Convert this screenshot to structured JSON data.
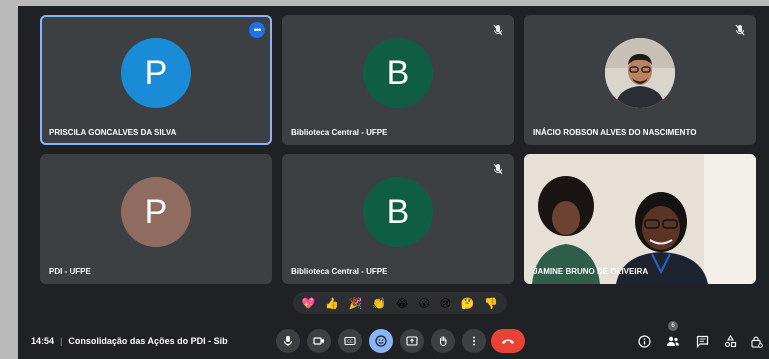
{
  "participants": [
    {
      "name": "PRISCILA GONCALVES DA SILVA",
      "initial": "P",
      "avatar_color": "#1a8bd6",
      "active": true,
      "muted": false
    },
    {
      "name": "Biblioteca Central - UFPE",
      "initial": "B",
      "avatar_color": "#0f5e44",
      "muted": true
    },
    {
      "name": "INÁCIO ROBSON ALVES DO NASCIMENTO",
      "avatar_type": "photo",
      "muted": true
    },
    {
      "name": "PDI - UFPE",
      "initial": "P",
      "avatar_color": "#8f6c5f",
      "muted": false
    },
    {
      "name": "Biblioteca Central - UFPE",
      "initial": "B",
      "avatar_color": "#0f5e44",
      "muted": true
    },
    {
      "name": "JAMINE BRUNO DE OLIVEIRA",
      "avatar_type": "video",
      "muted": false
    }
  ],
  "reactions": [
    "💖",
    "👍",
    "🎉",
    "👏",
    "😂",
    "😮",
    "😢",
    "🤔",
    "👎"
  ],
  "footer": {
    "time": "14:54",
    "separator": "|",
    "meeting_title": "Consolidação das Ações do PDI - Sib",
    "participants_count": "6"
  },
  "controls": [
    "mic-icon",
    "camera-icon",
    "captions-icon",
    "emoji-icon",
    "present-icon",
    "raise-hand-icon",
    "more-options-icon",
    "leave-call-icon"
  ],
  "right_controls": [
    "info-icon",
    "people-icon",
    "chat-icon",
    "activities-icon",
    "host-controls-icon"
  ],
  "colors": {
    "accent": "#8ab4f8",
    "leave": "#ea4335",
    "tile": "#3c4043",
    "background": "#202124"
  }
}
